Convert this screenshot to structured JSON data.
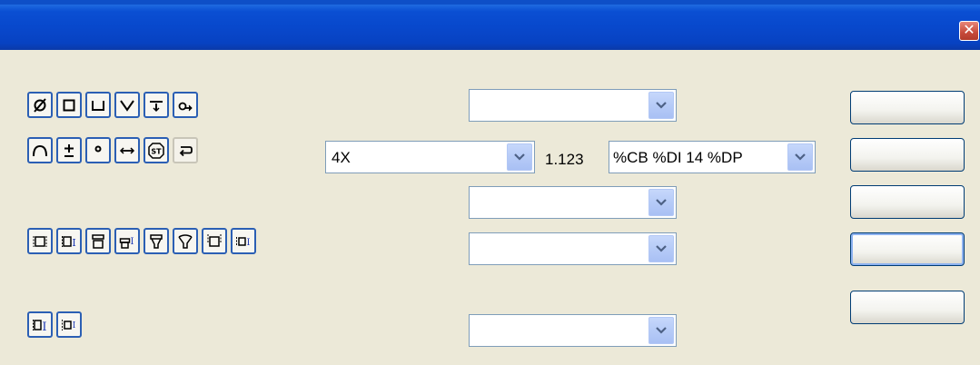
{
  "window": {
    "title": "",
    "close_label": "✕"
  },
  "toolbar_row1": {
    "icons": [
      "diameter-icon",
      "square-icon",
      "counterbore-icon",
      "countersink-icon",
      "depth-icon",
      "arc-length-icon"
    ]
  },
  "toolbar_row2": {
    "icons": [
      "arc-icon",
      "plus-minus-icon",
      "degree-icon",
      "dimension-line-icon",
      "statistical-icon",
      "return-arrow-icon"
    ]
  },
  "toolbar_row3": {
    "icons": [
      "frame-icon",
      "frame-text-icon",
      "frame-top-icon",
      "frame-top-text-icon",
      "funnel-icon",
      "funnel-top-icon",
      "frame-bottom-icon",
      "frame-text-small-icon"
    ]
  },
  "toolbar_row4": {
    "icons": [
      "insert-text-icon",
      "insert-frame-icon"
    ]
  },
  "combos": {
    "top": "",
    "prefix": "4X",
    "format": "%CB %DI 14 %DP",
    "middle1": "",
    "middle2": "",
    "bottom": ""
  },
  "value_display": "1.123",
  "buttons": [
    "",
    "",
    "",
    "",
    ""
  ]
}
